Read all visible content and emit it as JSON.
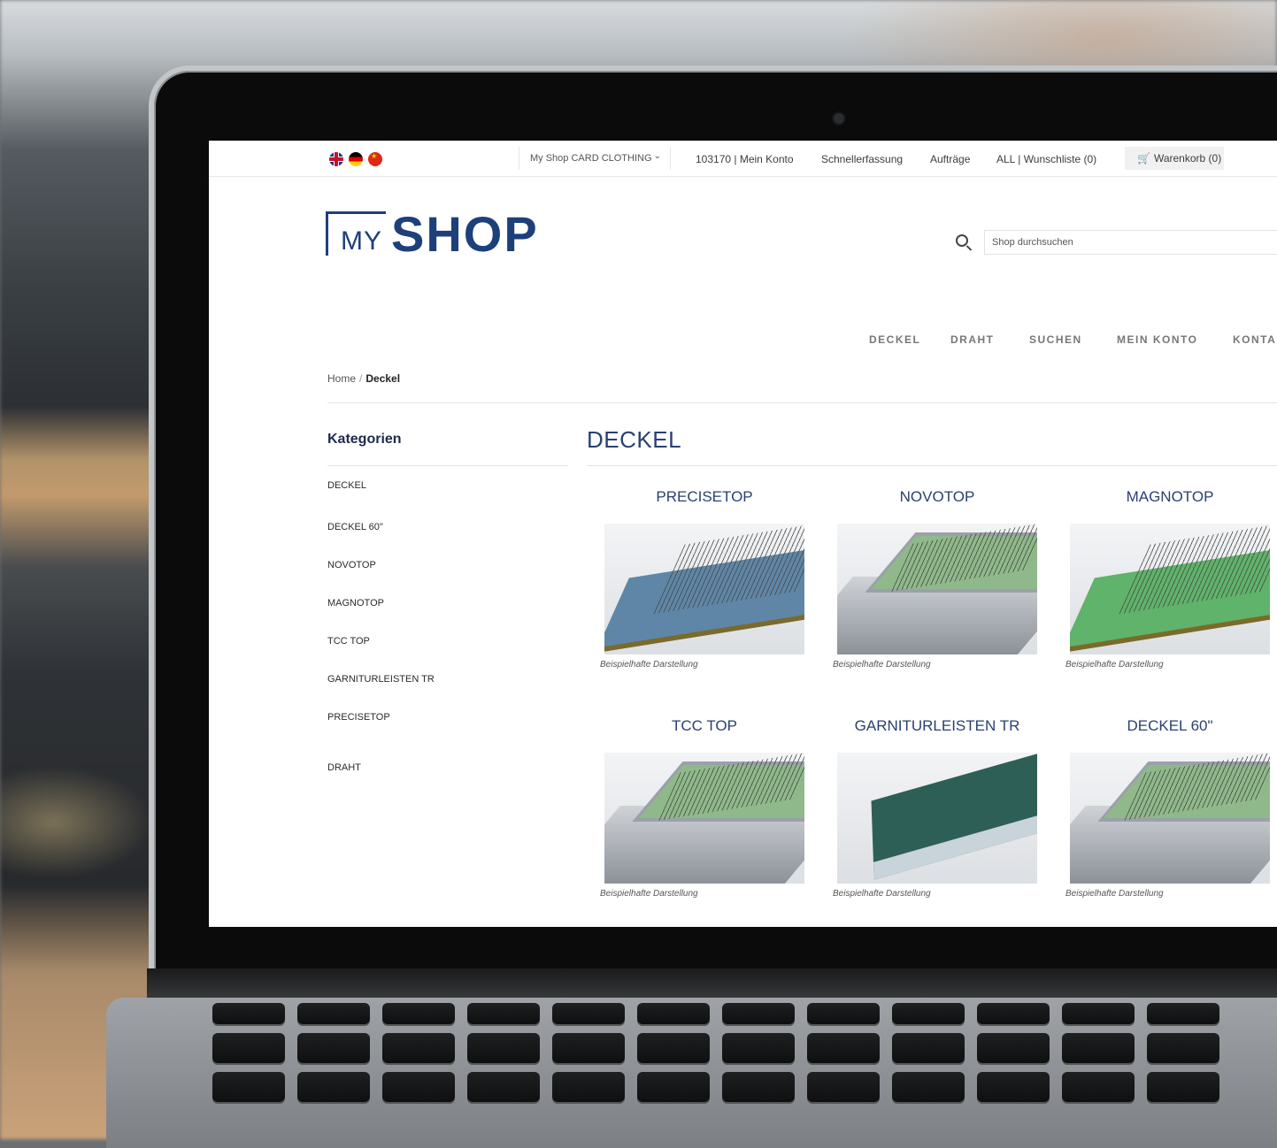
{
  "topbar": {
    "shop_select": "My Shop CARD CLOTHING",
    "account": "103170 | Mein Konto",
    "quick_entry": "Schnellerfassung",
    "orders": "Aufträge",
    "wishlist": "ALL | Wunschliste (0)",
    "cart": "Warenkorb (0)"
  },
  "logo": {
    "my": "MY",
    "shop": "SHOP"
  },
  "search": {
    "placeholder": "Shop durchsuchen"
  },
  "nav": [
    "DECKEL",
    "DRAHT",
    "SUCHEN",
    "MEIN KONTO",
    "KONTAK"
  ],
  "breadcrumb": {
    "home": "Home",
    "separator": "/",
    "current": "Deckel"
  },
  "sidebar": {
    "title": "Kategorien",
    "items": [
      "DECKEL",
      "DECKEL 60\"",
      "NOVOTOP",
      "MAGNOTOP",
      "TCC TOP",
      "GARNITURLEISTEN TR",
      "PRECISETOP",
      "DRAHT"
    ]
  },
  "page_title": "DECKEL",
  "products": [
    {
      "name": "PRECISETOP",
      "caption": "Beispielhafte Darstellung",
      "top_color": "#5f86a6"
    },
    {
      "name": "NOVOTOP",
      "caption": "Beispielhafte Darstellung",
      "top_color": "#8fb98a"
    },
    {
      "name": "MAGNOTOP",
      "caption": "Beispielhafte Darstellung",
      "top_color": "#5fb36a"
    },
    {
      "name": "TCC TOP",
      "caption": "Beispielhafte Darstellung",
      "top_color": "#8fb98a"
    },
    {
      "name": "GARNITURLEISTEN TR",
      "caption": "Beispielhafte Darstellung",
      "top_color": "#2e5f57"
    },
    {
      "name": "DECKEL 60\"",
      "caption": "Beispielhafte Darstellung",
      "top_color": "#8fb98a"
    }
  ],
  "colors": {
    "brand": "#1d3f7a",
    "heading": "#2a4173"
  }
}
